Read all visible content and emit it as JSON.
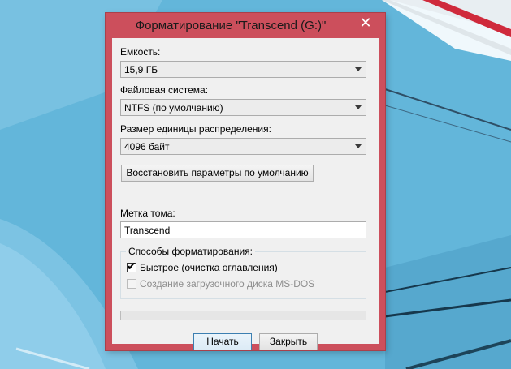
{
  "window": {
    "title": "Форматирование \"Transcend (G:)\"",
    "close_glyph": "✕"
  },
  "capacity": {
    "label": "Емкость:",
    "value": "15,9 ГБ"
  },
  "filesystem": {
    "label": "Файловая система:",
    "value": "NTFS (по умолчанию)"
  },
  "allocation": {
    "label": "Размер единицы распределения:",
    "value": "4096 байт"
  },
  "restore_defaults_label": "Восстановить параметры по умолчанию",
  "volume_label": {
    "label": "Метка тома:",
    "value": "Transcend"
  },
  "format_options": {
    "legend": "Способы форматирования:",
    "quick": {
      "label": "Быстрое (очистка оглавления)",
      "checked": true,
      "check_glyph": "✔"
    },
    "msdos": {
      "label": "Создание загрузочного диска MS-DOS",
      "checked": false,
      "enabled": false
    }
  },
  "progress": {
    "fraction": 0
  },
  "buttons": {
    "start": "Начать",
    "close": "Закрыть"
  },
  "colors": {
    "window_frame": "#cc4f5c",
    "desktop": "#63b6da",
    "dialog_bg": "#f0f0f0"
  }
}
